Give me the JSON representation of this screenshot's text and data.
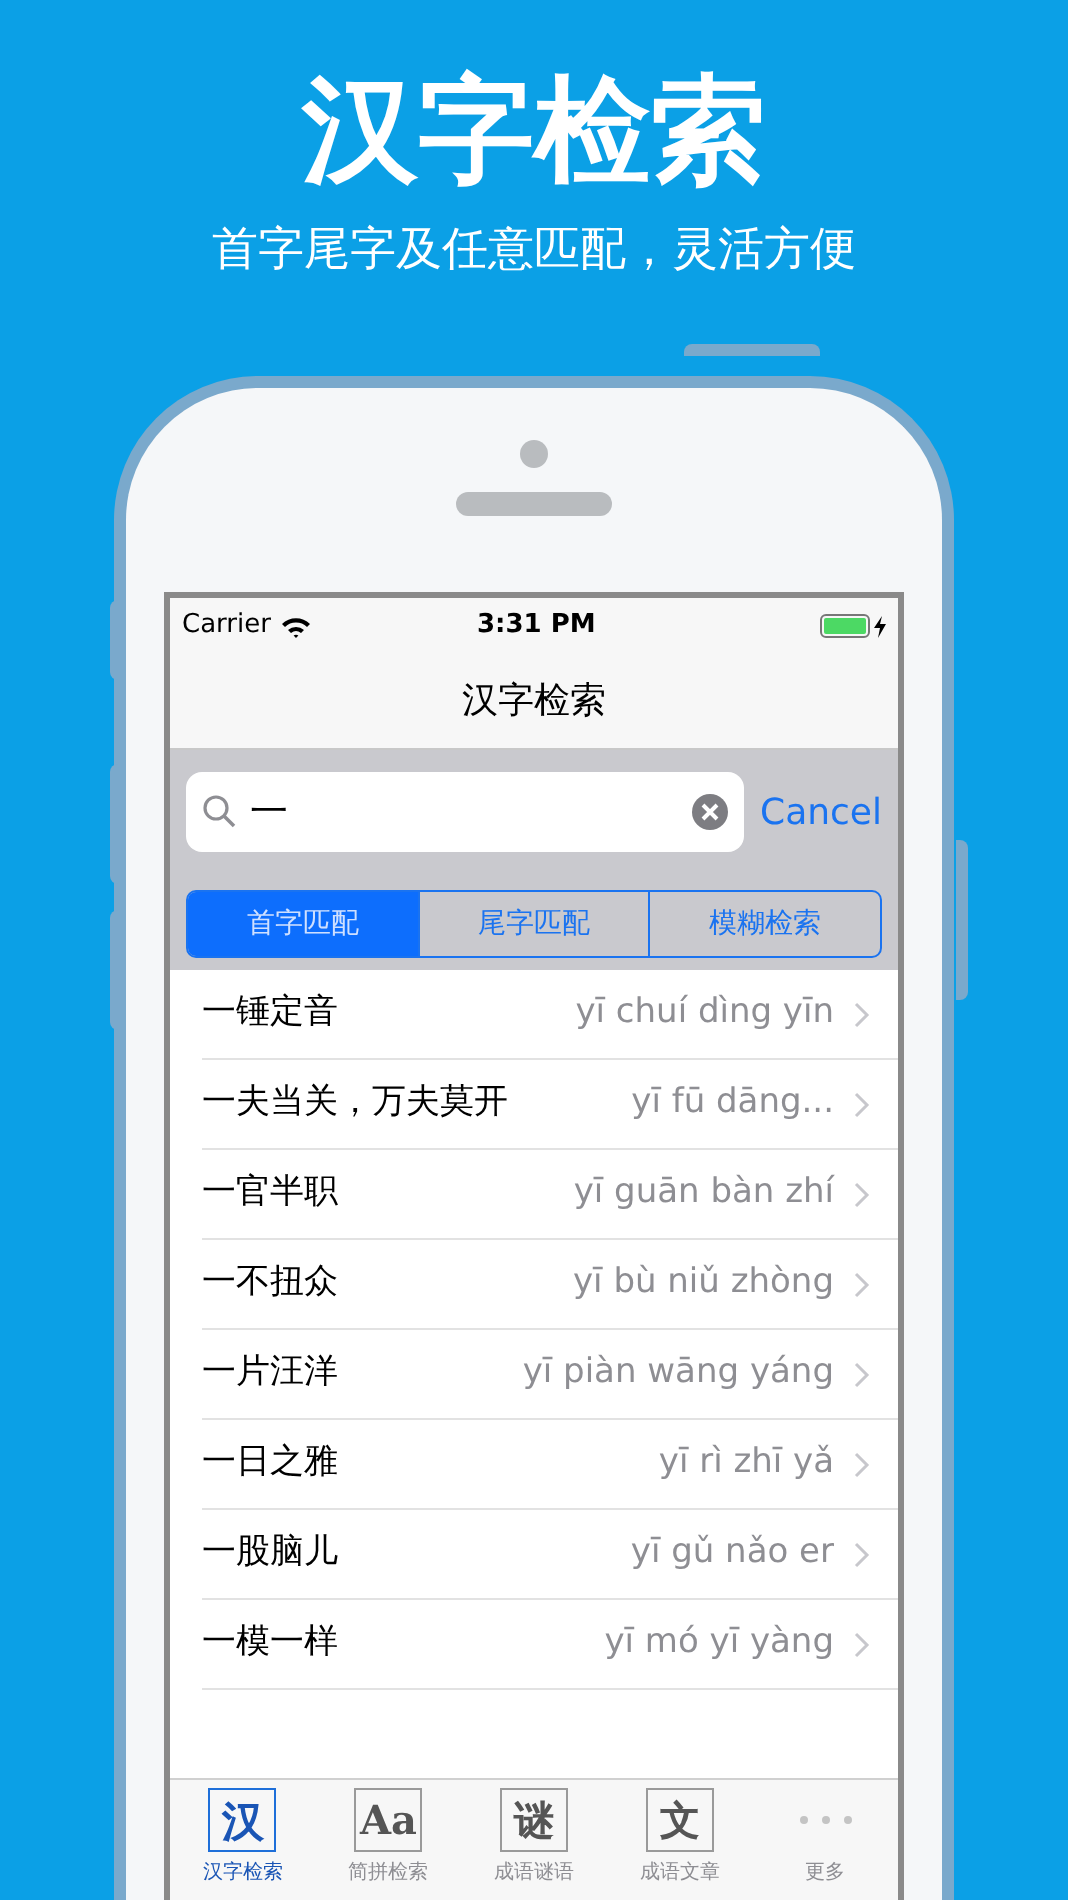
{
  "headline": "汉字检索",
  "tagline": "首字尾字及任意匹配，灵活方便",
  "status_bar": {
    "carrier": "Carrier",
    "time": "3:31 PM"
  },
  "nav": {
    "title": "汉字检索"
  },
  "search": {
    "value": "一",
    "cancel": "Cancel"
  },
  "segments": [
    {
      "label": "首字匹配",
      "selected": true
    },
    {
      "label": "尾字匹配",
      "selected": false
    },
    {
      "label": "模糊检索",
      "selected": false
    }
  ],
  "rows": [
    {
      "idiom": "一锤定音",
      "pinyin": "yī chuí dìng yīn"
    },
    {
      "idiom": "一夫当关，万夫莫开",
      "pinyin": "yī fū dāng..."
    },
    {
      "idiom": "一官半职",
      "pinyin": "yī guān bàn zhí"
    },
    {
      "idiom": "一不扭众",
      "pinyin": "yī bù niǔ zhòng"
    },
    {
      "idiom": "一片汪洋",
      "pinyin": "yī piàn wāng yáng"
    },
    {
      "idiom": "一日之雅",
      "pinyin": "yī rì zhī yǎ"
    },
    {
      "idiom": "一股脑儿",
      "pinyin": "yī gǔ nǎo er"
    },
    {
      "idiom": "一模一样",
      "pinyin": "yī mó yī yàng"
    }
  ],
  "tab_bar": [
    {
      "kind": "glyph",
      "glyph": "汉",
      "label": "汉字检索",
      "selected": true
    },
    {
      "kind": "glyph",
      "glyph": "Aa",
      "label": "简拼检索",
      "selected": false
    },
    {
      "kind": "glyph",
      "glyph": "谜",
      "label": "成语谜语",
      "selected": false
    },
    {
      "kind": "glyph",
      "glyph": "文",
      "label": "成语文章",
      "selected": false
    },
    {
      "kind": "more",
      "label": "更多",
      "selected": false
    }
  ]
}
